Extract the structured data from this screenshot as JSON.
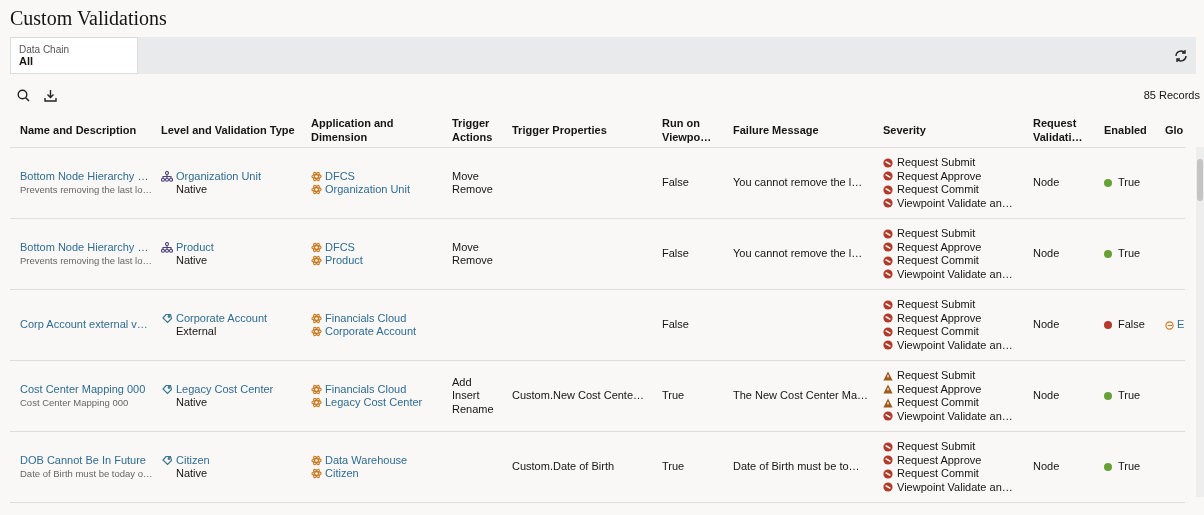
{
  "title": "Custom Validations",
  "filter": {
    "label": "Data Chain",
    "value": "All"
  },
  "records": "85 Records",
  "columns": [
    "Name and Description",
    "Level and Validation Type",
    "Application and Dimension",
    "Trigger Actions",
    "Trigger Properties",
    "Run on Viewpo…",
    "Failure Message",
    "Severity",
    "Request Validati…",
    "Enabled",
    "Glo"
  ],
  "rows": [
    {
      "name": "Bottom Node Hierarchy …",
      "description": "Prevents removing the last lo…",
      "level": "Organization Unit",
      "kind": "hierarchy",
      "validation_type": "Native",
      "application": "DFCS",
      "dimension": "Organization Unit",
      "trigger_actions": [
        "Move",
        "Remove"
      ],
      "run_on_viewpoint": "False",
      "failure_message": "You cannot remove the l…",
      "severity": [
        {
          "kind": "error",
          "text": "Request Submit"
        },
        {
          "kind": "error",
          "text": "Request Approve"
        },
        {
          "kind": "error",
          "text": "Request Commit"
        },
        {
          "kind": "error",
          "text": "Viewpoint Validate an…"
        }
      ],
      "request_validation": "Node",
      "enabled": true,
      "enabled_label": "True"
    },
    {
      "name": "Bottom Node Hierarchy …",
      "description": "Prevents removing the last lo…",
      "level": "Product",
      "kind": "hierarchy",
      "validation_type": "Native",
      "application": "DFCS",
      "dimension": "Product",
      "trigger_actions": [
        "Move",
        "Remove"
      ],
      "run_on_viewpoint": "False",
      "failure_message": "You cannot remove the l…",
      "severity": [
        {
          "kind": "error",
          "text": "Request Submit"
        },
        {
          "kind": "error",
          "text": "Request Approve"
        },
        {
          "kind": "error",
          "text": "Request Commit"
        },
        {
          "kind": "error",
          "text": "Viewpoint Validate an…"
        }
      ],
      "request_validation": "Node",
      "enabled": true,
      "enabled_label": "True"
    },
    {
      "name": "Corp Account external v…",
      "level": "Corporate Account",
      "kind": "link",
      "validation_type": "External",
      "application": "Financials Cloud",
      "dimension": "Corporate Account",
      "run_on_viewpoint": "False",
      "severity": [
        {
          "kind": "error",
          "text": "Request Submit"
        },
        {
          "kind": "error",
          "text": "Request Approve"
        },
        {
          "kind": "error",
          "text": "Request Commit"
        },
        {
          "kind": "error",
          "text": "Viewpoint Validate an…"
        }
      ],
      "request_validation": "Node",
      "enabled": false,
      "enabled_label": "False",
      "global": "E"
    },
    {
      "name": "Cost Center Mapping 000",
      "description": "Cost Center Mapping 000",
      "level": "Legacy Cost Center",
      "kind": "link",
      "validation_type": "Native",
      "application": "Financials Cloud",
      "dimension": "Legacy Cost Center",
      "trigger_actions": [
        "Add",
        "Insert",
        "Rename"
      ],
      "trigger_properties": "Custom.New Cost Cente…",
      "run_on_viewpoint": "True",
      "failure_message": "The New Cost Center Ma…",
      "severity": [
        {
          "kind": "warning",
          "text": "Request Submit"
        },
        {
          "kind": "warning",
          "text": "Request Approve"
        },
        {
          "kind": "warning",
          "text": "Request Commit"
        },
        {
          "kind": "error",
          "text": "Viewpoint Validate an…"
        }
      ],
      "request_validation": "Node",
      "enabled": true,
      "enabled_label": "True"
    },
    {
      "name": "DOB Cannot Be In Future",
      "description": "Date of Birth must be today o…",
      "level": "Citizen",
      "kind": "link",
      "validation_type": "Native",
      "application": "Data Warehouse",
      "dimension": "Citizen",
      "trigger_properties": "Custom.Date of Birth",
      "run_on_viewpoint": "True",
      "failure_message": "Date of Birth must be to…",
      "severity": [
        {
          "kind": "error",
          "text": "Request Submit"
        },
        {
          "kind": "error",
          "text": "Request Approve"
        },
        {
          "kind": "error",
          "text": "Request Commit"
        },
        {
          "kind": "error",
          "text": "Viewpoint Validate an…"
        }
      ],
      "request_validation": "Node",
      "enabled": true,
      "enabled_label": "True"
    }
  ]
}
